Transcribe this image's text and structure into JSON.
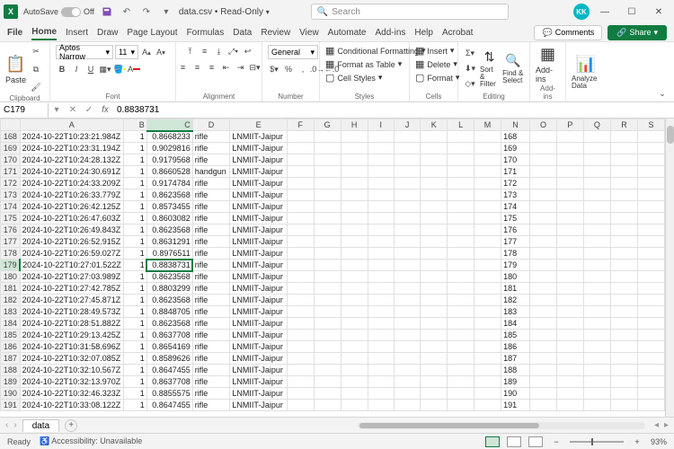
{
  "titlebar": {
    "autosave_label": "AutoSave",
    "autosave_state": "Off",
    "filename": "data.csv",
    "mode": "Read-Only",
    "search_placeholder": "Search",
    "user_initials": "KK"
  },
  "tabs": {
    "file": "File",
    "home": "Home",
    "insert": "Insert",
    "draw": "Draw",
    "page_layout": "Page Layout",
    "formulas": "Formulas",
    "data": "Data",
    "review": "Review",
    "view": "View",
    "automate": "Automate",
    "addins": "Add-ins",
    "help": "Help",
    "acrobat": "Acrobat",
    "comments": "Comments",
    "share": "Share"
  },
  "ribbon": {
    "paste": "Paste",
    "clipboard": "Clipboard",
    "font_name": "Aptos Narrow",
    "font_size": "11",
    "font_group": "Font",
    "alignment": "Alignment",
    "number_format": "General",
    "number": "Number",
    "cond_fmt": "Conditional Formatting",
    "fmt_table": "Format as Table",
    "cell_styles": "Cell Styles",
    "styles": "Styles",
    "insert": "Insert",
    "delete": "Delete",
    "format": "Format",
    "cells": "Cells",
    "sort_filter": "Sort & Filter",
    "find_select": "Find & Select",
    "editing": "Editing",
    "addins": "Add-ins",
    "analyze": "Analyze Data"
  },
  "formula_bar": {
    "name_box": "C179",
    "value": "0.8838731"
  },
  "columns": [
    "A",
    "B",
    "C",
    "D",
    "E",
    "F",
    "G",
    "H",
    "I",
    "J",
    "K",
    "L",
    "M",
    "N",
    "O",
    "P",
    "Q",
    "R",
    "S"
  ],
  "selected_row": 179,
  "selected_col": "C",
  "rows": [
    {
      "n": 168,
      "a": "2024-10-22T10:23:21.984Z",
      "b": 1,
      "c": "0.8668233",
      "d": "rifle",
      "e": "LNMIIT-Jaipur"
    },
    {
      "n": 169,
      "a": "2024-10-22T10:23:31.194Z",
      "b": 1,
      "c": "0.9029816",
      "d": "rifle",
      "e": "LNMIIT-Jaipur"
    },
    {
      "n": 170,
      "a": "2024-10-22T10:24:28.132Z",
      "b": 1,
      "c": "0.9179568",
      "d": "rifle",
      "e": "LNMIIT-Jaipur"
    },
    {
      "n": 171,
      "a": "2024-10-22T10:24:30.691Z",
      "b": 1,
      "c": "0.8660528",
      "d": "handgun",
      "e": "LNMIIT-Jaipur"
    },
    {
      "n": 172,
      "a": "2024-10-22T10:24:33.209Z",
      "b": 1,
      "c": "0.9174784",
      "d": "rifle",
      "e": "LNMIIT-Jaipur"
    },
    {
      "n": 173,
      "a": "2024-10-22T10:26:33.779Z",
      "b": 1,
      "c": "0.8623568",
      "d": "rifle",
      "e": "LNMIIT-Jaipur"
    },
    {
      "n": 174,
      "a": "2024-10-22T10:26:42.125Z",
      "b": 1,
      "c": "0.8573455",
      "d": "rifle",
      "e": "LNMIIT-Jaipur"
    },
    {
      "n": 175,
      "a": "2024-10-22T10:26:47.603Z",
      "b": 1,
      "c": "0.8603082",
      "d": "rifle",
      "e": "LNMIIT-Jaipur"
    },
    {
      "n": 176,
      "a": "2024-10-22T10:26:49.843Z",
      "b": 1,
      "c": "0.8623568",
      "d": "rifle",
      "e": "LNMIIT-Jaipur"
    },
    {
      "n": 177,
      "a": "2024-10-22T10:26:52.915Z",
      "b": 1,
      "c": "0.8631291",
      "d": "rifle",
      "e": "LNMIIT-Jaipur"
    },
    {
      "n": 178,
      "a": "2024-10-22T10:26:59.027Z",
      "b": 1,
      "c": "0.8976511",
      "d": "rifle",
      "e": "LNMIIT-Jaipur"
    },
    {
      "n": 179,
      "a": "2024-10-22T10:27:01.522Z",
      "b": 1,
      "c": "0.8838731",
      "d": "rifle",
      "e": "LNMIIT-Jaipur"
    },
    {
      "n": 180,
      "a": "2024-10-22T10:27:03.989Z",
      "b": 1,
      "c": "0.8623568",
      "d": "rifle",
      "e": "LNMIIT-Jaipur"
    },
    {
      "n": 181,
      "a": "2024-10-22T10:27:42.785Z",
      "b": 1,
      "c": "0.8803299",
      "d": "rifle",
      "e": "LNMIIT-Jaipur"
    },
    {
      "n": 182,
      "a": "2024-10-22T10:27:45.871Z",
      "b": 1,
      "c": "0.8623568",
      "d": "rifle",
      "e": "LNMIIT-Jaipur"
    },
    {
      "n": 183,
      "a": "2024-10-22T10:28:49.573Z",
      "b": 1,
      "c": "0.8848705",
      "d": "rifle",
      "e": "LNMIIT-Jaipur"
    },
    {
      "n": 184,
      "a": "2024-10-22T10:28:51.882Z",
      "b": 1,
      "c": "0.8623568",
      "d": "rifle",
      "e": "LNMIIT-Jaipur"
    },
    {
      "n": 185,
      "a": "2024-10-22T10:29:13.425Z",
      "b": 1,
      "c": "0.8637708",
      "d": "rifle",
      "e": "LNMIIT-Jaipur"
    },
    {
      "n": 186,
      "a": "2024-10-22T10:31:58.696Z",
      "b": 1,
      "c": "0.8654169",
      "d": "rifle",
      "e": "LNMIIT-Jaipur"
    },
    {
      "n": 187,
      "a": "2024-10-22T10:32:07.085Z",
      "b": 1,
      "c": "0.8589626",
      "d": "rifle",
      "e": "LNMIIT-Jaipur"
    },
    {
      "n": 188,
      "a": "2024-10-22T10:32:10.567Z",
      "b": 1,
      "c": "0.8647455",
      "d": "rifle",
      "e": "LNMIIT-Jaipur"
    },
    {
      "n": 189,
      "a": "2024-10-22T10:32:13.970Z",
      "b": 1,
      "c": "0.8637708",
      "d": "rifle",
      "e": "LNMIIT-Jaipur"
    },
    {
      "n": 190,
      "a": "2024-10-22T10:32:46.323Z",
      "b": 1,
      "c": "0.8855575",
      "d": "rifle",
      "e": "LNMIIT-Jaipur"
    },
    {
      "n": 191,
      "a": "2024-10-22T10:33:08.122Z",
      "b": 1,
      "c": "0.8647455",
      "d": "rifle",
      "e": "LNMIIT-Jaipur"
    }
  ],
  "sheet_tabs": {
    "name": "data"
  },
  "statusbar": {
    "ready": "Ready",
    "accessibility": "Accessibility: Unavailable",
    "zoom": "93%"
  }
}
